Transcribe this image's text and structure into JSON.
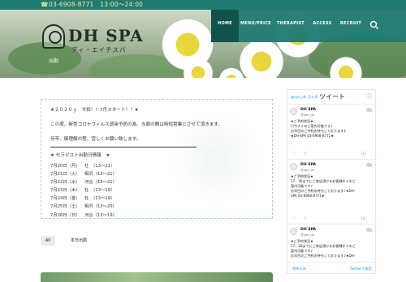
{
  "topbar": {
    "phone": "03-6908-8771　13:00〜24:00",
    "phone_icon": "phone-icon"
  },
  "brand": {
    "name": "DH SPA",
    "kana": "ディ・エイチスパ",
    "emblem": "horseshoe-emblem"
  },
  "nav": {
    "items": [
      {
        "label": "HOME",
        "active": true
      },
      {
        "label": "MENU/PRICE"
      },
      {
        "label": "THERAPIST"
      },
      {
        "label": "ACCESS"
      },
      {
        "label": "RECRUIT"
      }
    ],
    "search_icon": "search-icon"
  },
  "hero": {
    "crumb": "出勤"
  },
  "post": {
    "line1": "★２０２０ｙ　令和！！7月スタート！！★",
    "line2": "この度、新型コロナウィルス感染予防の為、当面の間は時短営業とさせて頂きます。",
    "line3": "何卒、御理解の程、宜しくお願い致します。",
    "sched_title": "★ セラピスト出勤日情報　★",
    "schedule": [
      {
        "date": "7月20日（月）",
        "text": "杜　（13～21）"
      },
      {
        "date": "7月21日（火）",
        "text": "相沢（13～21）"
      },
      {
        "date": "7月22日（水）",
        "text": "河合（13～21）"
      },
      {
        "date": "7月23日（木）",
        "text": "杜　（13～19）"
      },
      {
        "date": "7月24日（金）",
        "text": "杜　（13～19）"
      },
      {
        "date": "7月25日（土）",
        "text": "相沢（13～20）"
      },
      {
        "date": "7月26日（日）",
        "text": "河合（13～19）"
      }
    ]
  },
  "tags": {
    "all": "All",
    "category": "本日出勤"
  },
  "twitter": {
    "handle": "@spa_dh さんの",
    "title": "ツイート",
    "more": "ⓘ",
    "tweets": [
      {
        "name": "DH SPA",
        "id": "@spa_dh",
        "lines": [
          "★ご予約状況★",
          "只今すぐのご案内可能です♪",
          "お早目のご予約お待ちしております2",
          "★DH-SPA 03-6908-8771★"
        ],
        "time": "1日"
      },
      {
        "name": "DH SPA",
        "id": "@spa_dh",
        "lines": [
          "★ご予約状況★",
          "17：30までにご来店頂けるお客様すぐのご",
          "案内可能です♪",
          "お早目のご予約お待ちしております♪★DH-",
          "SPA 03-6908-8771★"
        ],
        "time": "1日"
      },
      {
        "name": "DH SPA",
        "id": "@spa_dh",
        "lines": [
          "★ご予約状況★",
          "17：30までにご来店頂けるお客様すぐのご",
          "案内可能です♪",
          "お早目のご予約お待ちしております♪★DH-"
        ],
        "time": ""
      }
    ],
    "embed": "埋め込み",
    "view": "Twitterで表示"
  }
}
